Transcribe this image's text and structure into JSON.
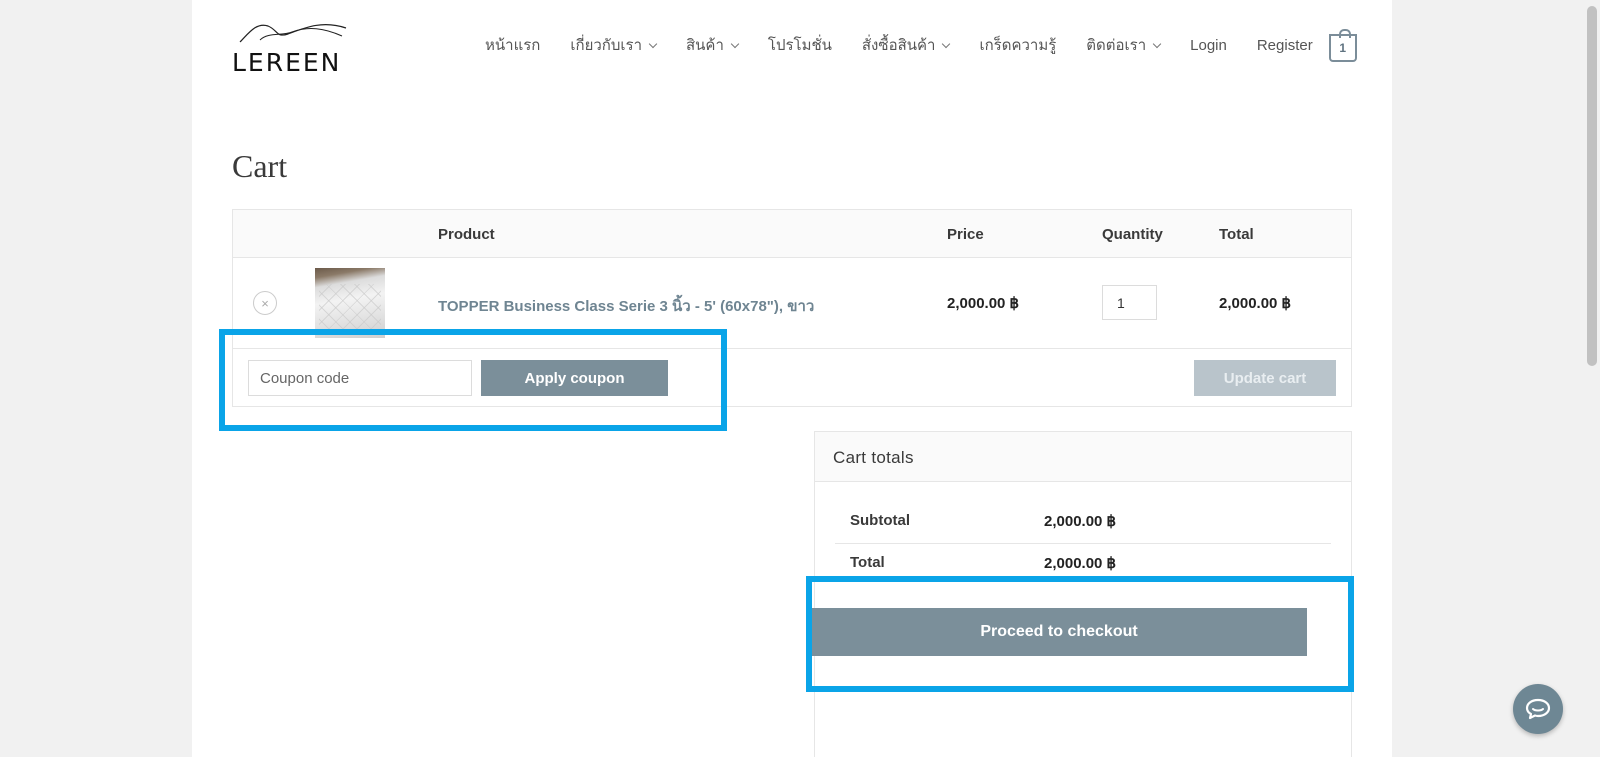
{
  "brand": {
    "name": "LEREEN"
  },
  "nav": {
    "items": [
      {
        "label": "หน้าแรก",
        "dropdown": false
      },
      {
        "label": "เกี่ยวกับเรา",
        "dropdown": true
      },
      {
        "label": "สินค้า",
        "dropdown": true
      },
      {
        "label": "โปรโมชั่น",
        "dropdown": false
      },
      {
        "label": "สั่งซื้อสินค้า",
        "dropdown": true
      },
      {
        "label": "เกร็ดความรู้",
        "dropdown": false
      },
      {
        "label": "ติดต่อเรา",
        "dropdown": true
      },
      {
        "label": "Login",
        "dropdown": false
      },
      {
        "label": "Register",
        "dropdown": false
      }
    ],
    "cart_count": "1"
  },
  "page": {
    "title": "Cart"
  },
  "cart": {
    "headers": {
      "product": "Product",
      "price": "Price",
      "quantity": "Quantity",
      "total": "Total"
    },
    "items": [
      {
        "name": "TOPPER Business Class Serie 3 นิ้ว - 5' (60x78\"), ขาว",
        "price": "2,000.00 ฿",
        "quantity": "1",
        "total": "2,000.00 ฿"
      }
    ],
    "remove_icon": "×",
    "coupon_placeholder": "Coupon code",
    "apply_label": "Apply coupon",
    "update_label": "Update cart"
  },
  "totals": {
    "title": "Cart totals",
    "subtotal_label": "Subtotal",
    "subtotal_value": "2,000.00 ฿",
    "total_label": "Total",
    "total_value": "2,000.00 ฿",
    "checkout_label": "Proceed to checkout"
  },
  "colors": {
    "accent": "#7b8f9a",
    "highlight": "#0aa4e8",
    "link": "#6f8592"
  },
  "icons": {
    "chat": "chat-bubble-icon",
    "cart": "shopping-bag-icon",
    "remove": "remove-circle-icon"
  }
}
